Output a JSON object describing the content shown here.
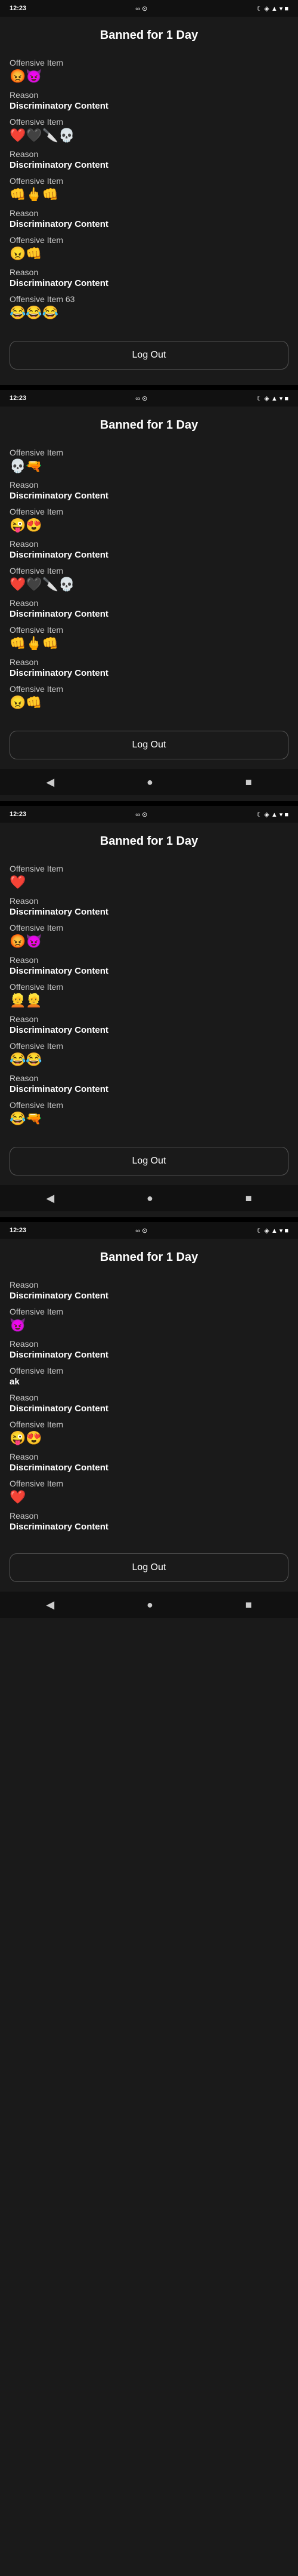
{
  "screens": [
    {
      "id": "screen1",
      "header": "Banned for 1 Day",
      "statusBar": {
        "time": "12:23",
        "icons": "∞ ⊙",
        "rightIcons": "☾ ◈ ▲ ▾ ■"
      },
      "items": [
        {
          "label": "Offensive Item",
          "value": "",
          "isEmoji": true,
          "emoji": "😡😈"
        },
        {
          "label": "Reason",
          "value": "Discriminatory Content",
          "isEmoji": false
        },
        {
          "label": "Offensive Item",
          "value": "",
          "isEmoji": true,
          "emoji": "❤️🖤🔪💀"
        },
        {
          "label": "Reason",
          "value": "Discriminatory Content",
          "isEmoji": false
        },
        {
          "label": "Offensive Item",
          "value": "",
          "isEmoji": true,
          "emoji": "👊🖕👊"
        },
        {
          "label": "Reason",
          "value": "Discriminatory Content",
          "isEmoji": false
        },
        {
          "label": "Offensive Item",
          "value": "",
          "isEmoji": true,
          "emoji": "😠👊"
        },
        {
          "label": "Reason",
          "value": "Discriminatory Content",
          "isEmoji": false
        },
        {
          "label": "Offensive Item 63",
          "value": "",
          "isEmoji": true,
          "emoji": "😂😂😂"
        }
      ],
      "logoutLabel": "Log Out",
      "showNav": false
    },
    {
      "id": "screen2",
      "header": "Banned for 1 Day",
      "statusBar": {
        "time": "12:23",
        "icons": "∞ ⊙",
        "rightIcons": "☾ ◈ ▲ ▾ ■"
      },
      "items": [
        {
          "label": "Offensive Item",
          "value": "",
          "isEmoji": true,
          "emoji": "💀🔫"
        },
        {
          "label": "Reason",
          "value": "Discriminatory Content",
          "isEmoji": false
        },
        {
          "label": "Offensive Item",
          "value": "",
          "isEmoji": true,
          "emoji": "😜😍"
        },
        {
          "label": "Reason",
          "value": "Discriminatory Content",
          "isEmoji": false
        },
        {
          "label": "Offensive Item",
          "value": "",
          "isEmoji": true,
          "emoji": "❤️🖤🔪💀"
        },
        {
          "label": "Reason",
          "value": "Discriminatory Content",
          "isEmoji": false
        },
        {
          "label": "Offensive Item",
          "value": "",
          "isEmoji": true,
          "emoji": "👊🖕👊"
        },
        {
          "label": "Reason",
          "value": "Discriminatory Content",
          "isEmoji": false
        },
        {
          "label": "Offensive Item",
          "value": "",
          "isEmoji": true,
          "emoji": "😠👊"
        }
      ],
      "logoutLabel": "Log Out",
      "showNav": true
    },
    {
      "id": "screen3",
      "header": "Banned for 1 Day",
      "statusBar": {
        "time": "12:23",
        "icons": "∞ ⊙",
        "rightIcons": "☾ ◈ ▲ ▾ ■"
      },
      "items": [
        {
          "label": "Offensive Item",
          "value": "",
          "isEmoji": true,
          "emoji": "❤️"
        },
        {
          "label": "Reason",
          "value": "Discriminatory Content",
          "isEmoji": false
        },
        {
          "label": "Offensive Item",
          "value": "",
          "isEmoji": true,
          "emoji": "😡😈"
        },
        {
          "label": "Reason",
          "value": "Discriminatory Content",
          "isEmoji": false
        },
        {
          "label": "Offensive Item",
          "value": "",
          "isEmoji": true,
          "emoji": "👱👱"
        },
        {
          "label": "Reason",
          "value": "Discriminatory Content",
          "isEmoji": false
        },
        {
          "label": "Offensive Item",
          "value": "",
          "isEmoji": true,
          "emoji": "😂😂"
        },
        {
          "label": "Reason",
          "value": "Discriminatory Content",
          "isEmoji": false
        },
        {
          "label": "Offensive Item",
          "value": "",
          "isEmoji": true,
          "emoji": "😂🔫"
        }
      ],
      "logoutLabel": "Log Out",
      "showNav": true
    },
    {
      "id": "screen4",
      "header": "Banned for 1 Day",
      "statusBar": {
        "time": "12:23",
        "icons": "∞ ⊙",
        "rightIcons": "☾ ◈ ▲ ▾ ■"
      },
      "items": [
        {
          "label": "Reason",
          "value": "Discriminatory Content",
          "isEmoji": false
        },
        {
          "label": "Offensive Item",
          "value": "",
          "isEmoji": true,
          "emoji": "😈"
        },
        {
          "label": "Reason",
          "value": "Discriminatory Content",
          "isEmoji": false
        },
        {
          "label": "Offensive Item",
          "value": "ak",
          "isEmoji": false
        },
        {
          "label": "Reason",
          "value": "Discriminatory Content",
          "isEmoji": false
        },
        {
          "label": "Offensive Item",
          "value": "",
          "isEmoji": true,
          "emoji": "😜😍"
        },
        {
          "label": "Reason",
          "value": "Discriminatory Content",
          "isEmoji": false
        },
        {
          "label": "Offensive Item",
          "value": "",
          "isEmoji": true,
          "emoji": "❤️"
        },
        {
          "label": "Reason",
          "value": "Discriminatory Content",
          "isEmoji": false
        }
      ],
      "logoutLabel": "Log Out",
      "showNav": true
    }
  ],
  "nav": {
    "back": "◀",
    "home": "●",
    "recent": "■"
  }
}
